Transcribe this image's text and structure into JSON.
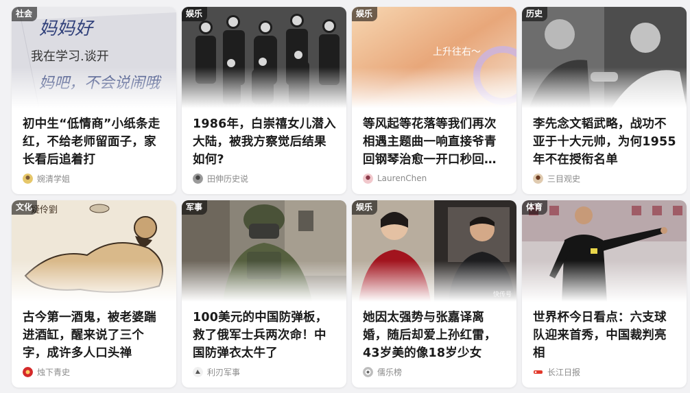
{
  "feed": {
    "cards": [
      {
        "category": "社会",
        "title": "初中生“低情商”小纸条走红，不给老师留面子，家长看后追着打",
        "author": "婉清学姐",
        "note_lines": [
          "妈妈好",
          "我在学习.谈开",
          "妈吧，不会说闹哦"
        ]
      },
      {
        "category": "娱乐",
        "title": "1986年，白崇禧女儿潜入大陆，被我方察觉后结果如何?",
        "author": "田伸历史说"
      },
      {
        "category": "娱乐",
        "title": "等风起等花落等我们再次相遇主题曲一响直接爷青回钢琴治愈一开口秒回…",
        "author": "LaurenChen",
        "overlay_text": "上升往右～"
      },
      {
        "category": "历史",
        "title": "李先念文韬武略，战功不亚于十大元帅，为何1955年不在授衔名单",
        "author": "三目观史"
      },
      {
        "category": "文化",
        "title": "古今第一酒鬼，被老婆踹进酒缸，醒来说了三个字，成许多人口头禅",
        "author": "烛下青史",
        "painting_text": "疑伶劉"
      },
      {
        "category": "军事",
        "title": "100美元的中国防弹板，救了俄军士兵两次命！中国防弹衣太牛了",
        "author": "利刃军事"
      },
      {
        "category": "娱乐",
        "title": "她因太强势与张嘉译离婚，随后却爱上孙红雷，43岁美的像18岁少女",
        "author": "儒乐榜",
        "watermark": "快传号"
      },
      {
        "category": "体育",
        "title": "世界杯今日看点：六支球队迎来首秀，中国裁判亮相",
        "author": "长江日报"
      }
    ]
  },
  "colors": {
    "badge_bg": "#00000088",
    "title": "#1a1a1a",
    "author": "#8a8a8a",
    "page_bg": "#f2f2f4"
  }
}
